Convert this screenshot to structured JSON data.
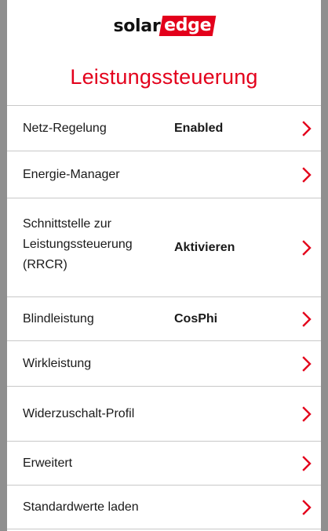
{
  "app": {
    "brand_part1": "solar",
    "brand_part2": "edge",
    "brand_color": "#e3001b",
    "page_title": "Leistungssteuerung"
  },
  "menu": {
    "items": [
      {
        "label": "Netz-Regelung",
        "value": "Enabled"
      },
      {
        "label": "Energie-Manager",
        "value": ""
      },
      {
        "label": "Schnittstelle zur\nLeistungssteuerung\n(RRCR)",
        "value": "Aktivieren"
      },
      {
        "label": "Blindleistung",
        "value": "CosPhi"
      },
      {
        "label": "Wirkleistung",
        "value": ""
      },
      {
        "label": "Widerzuschalt-Profil",
        "value": ""
      },
      {
        "label": "Erweitert",
        "value": ""
      },
      {
        "label": "Standardwerte laden",
        "value": ""
      }
    ],
    "icon": "chevron-right-icon"
  }
}
